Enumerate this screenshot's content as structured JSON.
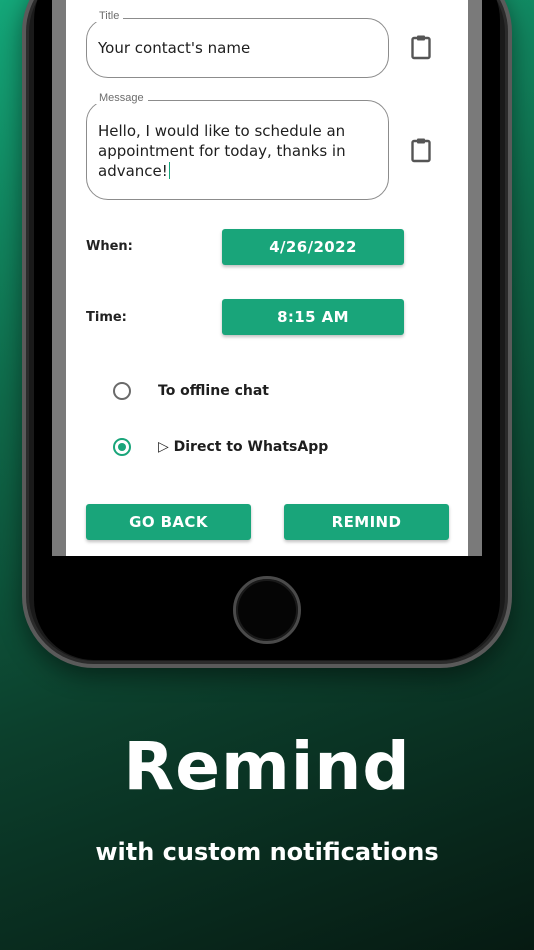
{
  "form": {
    "title": {
      "label": "Title",
      "value": "Your contact's name"
    },
    "message": {
      "label": "Message",
      "value": "Hello, I would like to schedule an appointment for today, thanks in advance!"
    },
    "when": {
      "label": "When:",
      "value": "4/26/2022"
    },
    "time": {
      "label": "Time:",
      "value": "8:15 AM"
    },
    "options": [
      {
        "label": "To offline chat",
        "selected": false
      },
      {
        "label": "▷ Direct to WhatsApp",
        "selected": true
      }
    ],
    "go_back_label": "GO BACK",
    "remind_label": "REMIND"
  },
  "promo": {
    "headline": "Remind",
    "subline": "with custom notifications"
  },
  "colors": {
    "accent": "#19a57a"
  },
  "icons": {
    "paste": "clipboard-icon"
  }
}
